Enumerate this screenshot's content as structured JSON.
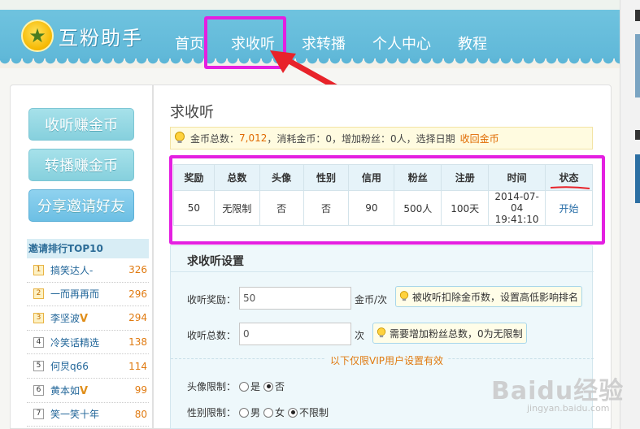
{
  "header": {
    "logo_text": "互粉助手",
    "nav": [
      {
        "label": "首页"
      },
      {
        "label": "求收听"
      },
      {
        "label": "求转播"
      },
      {
        "label": "个人中心"
      },
      {
        "label": "教程"
      }
    ],
    "active_nav": "求收听"
  },
  "sidebar": {
    "buttons": [
      {
        "label": "收听赚金币"
      },
      {
        "label": "转播赚金币"
      },
      {
        "label": "分享邀请好友"
      }
    ],
    "ranking": {
      "title": "邀请排行TOP10",
      "items": [
        {
          "rank": "1",
          "name": "搞笑达人-",
          "vip": "",
          "score": "326"
        },
        {
          "rank": "2",
          "name": "一而再再而",
          "vip": "",
          "score": "296"
        },
        {
          "rank": "3",
          "name": "李坚波",
          "vip": "V",
          "score": "294"
        },
        {
          "rank": "4",
          "name": "冷笑话精选",
          "vip": "",
          "score": "138"
        },
        {
          "rank": "5",
          "name": "何炅q66",
          "vip": "",
          "score": "114"
        },
        {
          "rank": "6",
          "name": "黄本如",
          "vip": "V",
          "score": "99"
        },
        {
          "rank": "7",
          "name": "笑一笑十年",
          "vip": "",
          "score": "80"
        }
      ]
    }
  },
  "main": {
    "title": "求收听",
    "coin_bar": {
      "total_label": "金币总数：",
      "total_value": "7,012",
      "consumed_text": "，消耗金币：0，增加粉丝：0人，选择日期",
      "recover_link": "收回金币"
    },
    "table": {
      "headers": [
        "奖励",
        "总数",
        "头像",
        "性别",
        "信用",
        "粉丝",
        "注册",
        "时间",
        "状态"
      ],
      "rows": [
        {
          "reward": "50",
          "total": "无限制",
          "avatar": "否",
          "gender": "否",
          "credit": "90",
          "fans": "500人",
          "register": "100天",
          "time_date": "2014-07-04",
          "time_clock": "19:41:10",
          "status": "开始"
        }
      ]
    },
    "settings": {
      "title": "求收听设置",
      "reward_label": "收听奖励：",
      "reward_value": "50",
      "reward_unit": "金币/次",
      "reward_tip": "被收听扣除金币数，设置高低影响排名",
      "total_label": "收听总数：",
      "total_value": "0",
      "total_unit": "次",
      "total_tip": "需要增加粉丝总数，0为无限制",
      "vip_notice": "以下仅限VIP用户设置有效",
      "avatar_label": "头像限制：",
      "avatar_options": [
        "是",
        "否"
      ],
      "avatar_selected": "否",
      "gender_label": "性别限制：",
      "gender_options": [
        "男",
        "女",
        "不限制"
      ],
      "gender_selected": "不限制"
    }
  },
  "watermark": {
    "brand": "Baidu经验",
    "url": "jingyan.baidu.com"
  },
  "colors": {
    "header_bg": "#5db6d7",
    "highlight": "#e41fe1",
    "arrow": "#e8232a",
    "accent_orange": "#e07a10",
    "link_blue": "#2a6fa8"
  }
}
